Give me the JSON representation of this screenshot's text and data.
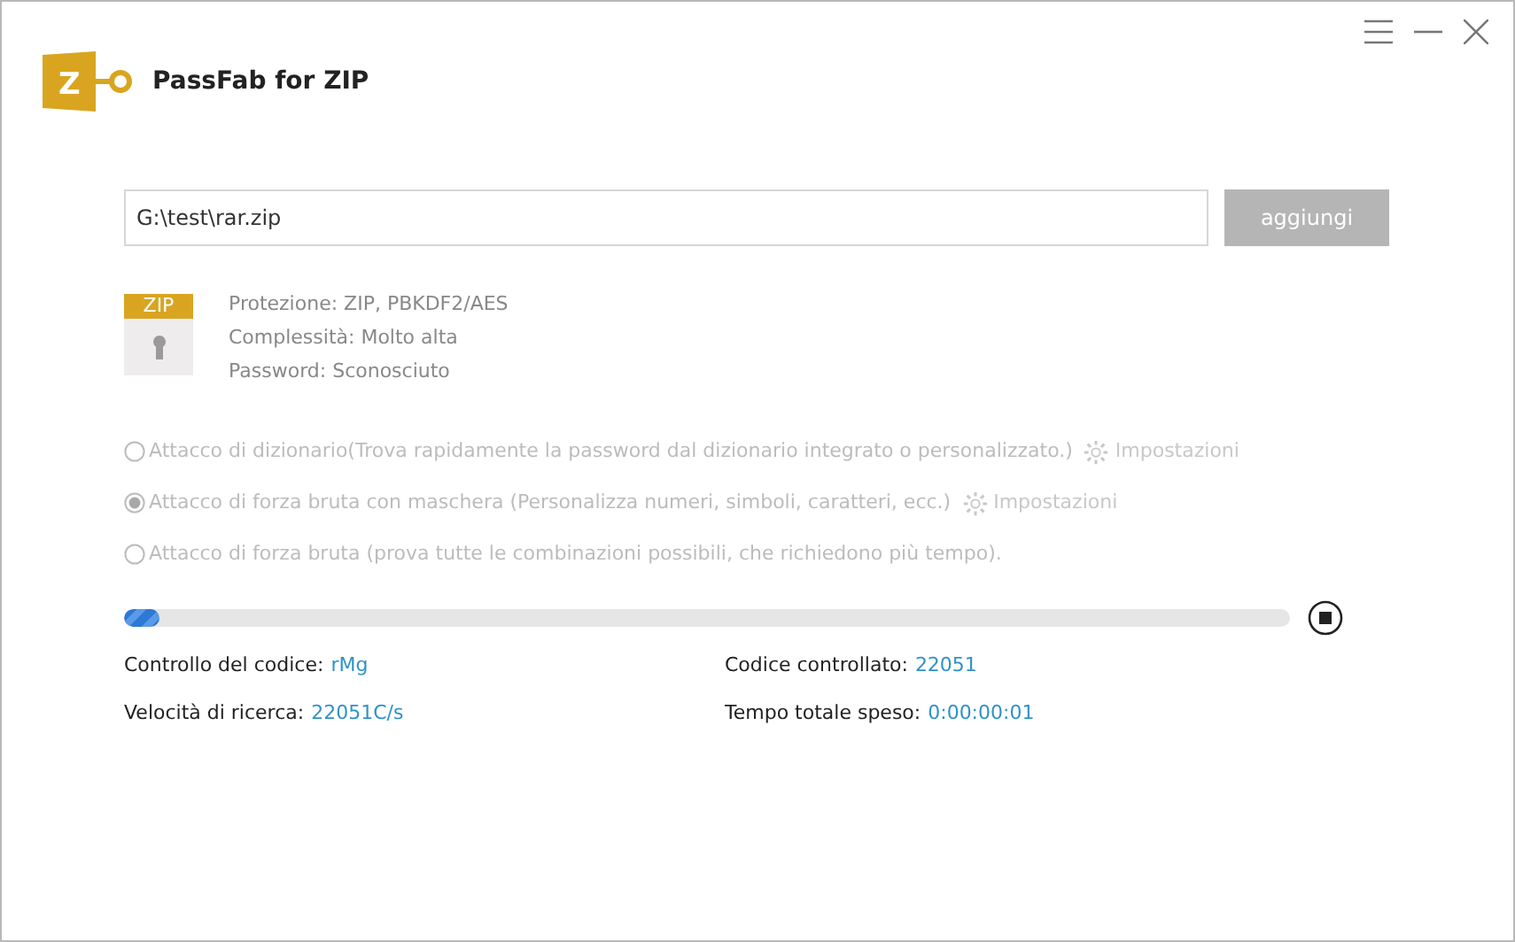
{
  "app": {
    "title": "PassFab for ZIP",
    "logo_letter": "Z"
  },
  "file": {
    "path": "G:\\test\\rar.zip",
    "add_button": {
      "label": "aggiungi",
      "disabled": true
    }
  },
  "file_info": {
    "badge": "ZIP",
    "lines": [
      "Protezione: ZIP, PBKDF2/AES",
      "Complessità: Molto alta",
      "Password: Sconosciuto"
    ]
  },
  "attacks": [
    {
      "label": "Attacco di dizionario(Trova rapidamente la password dal dizionario integrato o personalizzato.)",
      "selected": false,
      "disabled": true,
      "settings": "Impostazioni"
    },
    {
      "label": "Attacco di forza bruta con maschera (Personalizza numeri, simboli, caratteri, ecc.)",
      "selected": true,
      "disabled": true,
      "settings": "Impostazioni"
    },
    {
      "label": "Attacco di forza bruta (prova tutte le combinazioni possibili, che richiedono più tempo).",
      "selected": false,
      "disabled": true
    }
  ],
  "progress": {
    "level": 0.03
  },
  "stats": [
    {
      "label": "Controllo del codice:",
      "value": "rMg"
    },
    {
      "label": "Codice controllato:",
      "value": "22051"
    },
    {
      "label": "Velocità di ricerca:",
      "value": "22051C/s"
    },
    {
      "label": "Tempo totale speso:",
      "value": "0:00:00:01"
    }
  ]
}
